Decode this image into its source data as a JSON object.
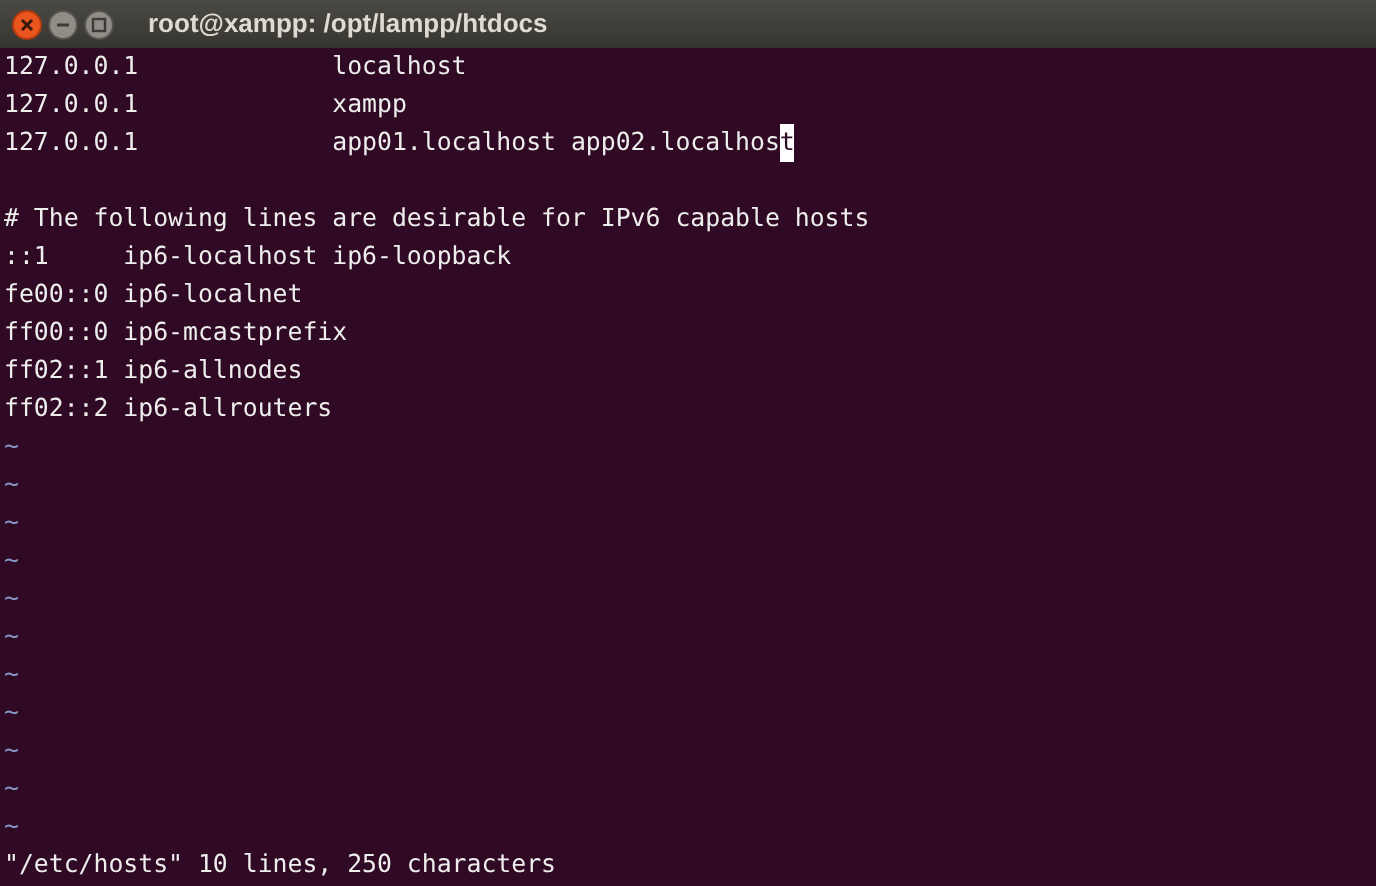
{
  "window": {
    "title": "root@xampp: /opt/lampp/htdocs"
  },
  "buffer": {
    "lines": [
      {
        "kind": "text",
        "text": "127.0.0.1             localhost"
      },
      {
        "kind": "text",
        "text": "127.0.0.1             xampp"
      },
      {
        "kind": "cursor",
        "text": "127.0.0.1             app01.localhost app02.localhos",
        "cursor_char": "t"
      },
      {
        "kind": "blank"
      },
      {
        "kind": "text",
        "text": "# The following lines are desirable for IPv6 capable hosts"
      },
      {
        "kind": "text",
        "text": "::1     ip6-localhost ip6-loopback"
      },
      {
        "kind": "text",
        "text": "fe00::0 ip6-localnet"
      },
      {
        "kind": "text",
        "text": "ff00::0 ip6-mcastprefix"
      },
      {
        "kind": "text",
        "text": "ff02::1 ip6-allnodes"
      },
      {
        "kind": "text",
        "text": "ff02::2 ip6-allrouters"
      },
      {
        "kind": "empty",
        "marker": "~"
      },
      {
        "kind": "empty",
        "marker": "~"
      },
      {
        "kind": "empty",
        "marker": "~"
      },
      {
        "kind": "empty",
        "marker": "~"
      },
      {
        "kind": "empty",
        "marker": "~"
      },
      {
        "kind": "empty",
        "marker": "~"
      },
      {
        "kind": "empty",
        "marker": "~"
      },
      {
        "kind": "empty",
        "marker": "~"
      },
      {
        "kind": "empty",
        "marker": "~"
      },
      {
        "kind": "empty",
        "marker": "~"
      },
      {
        "kind": "empty",
        "marker": "~"
      }
    ]
  },
  "status_line": "\"/etc/hosts\" 10 lines, 250 characters"
}
